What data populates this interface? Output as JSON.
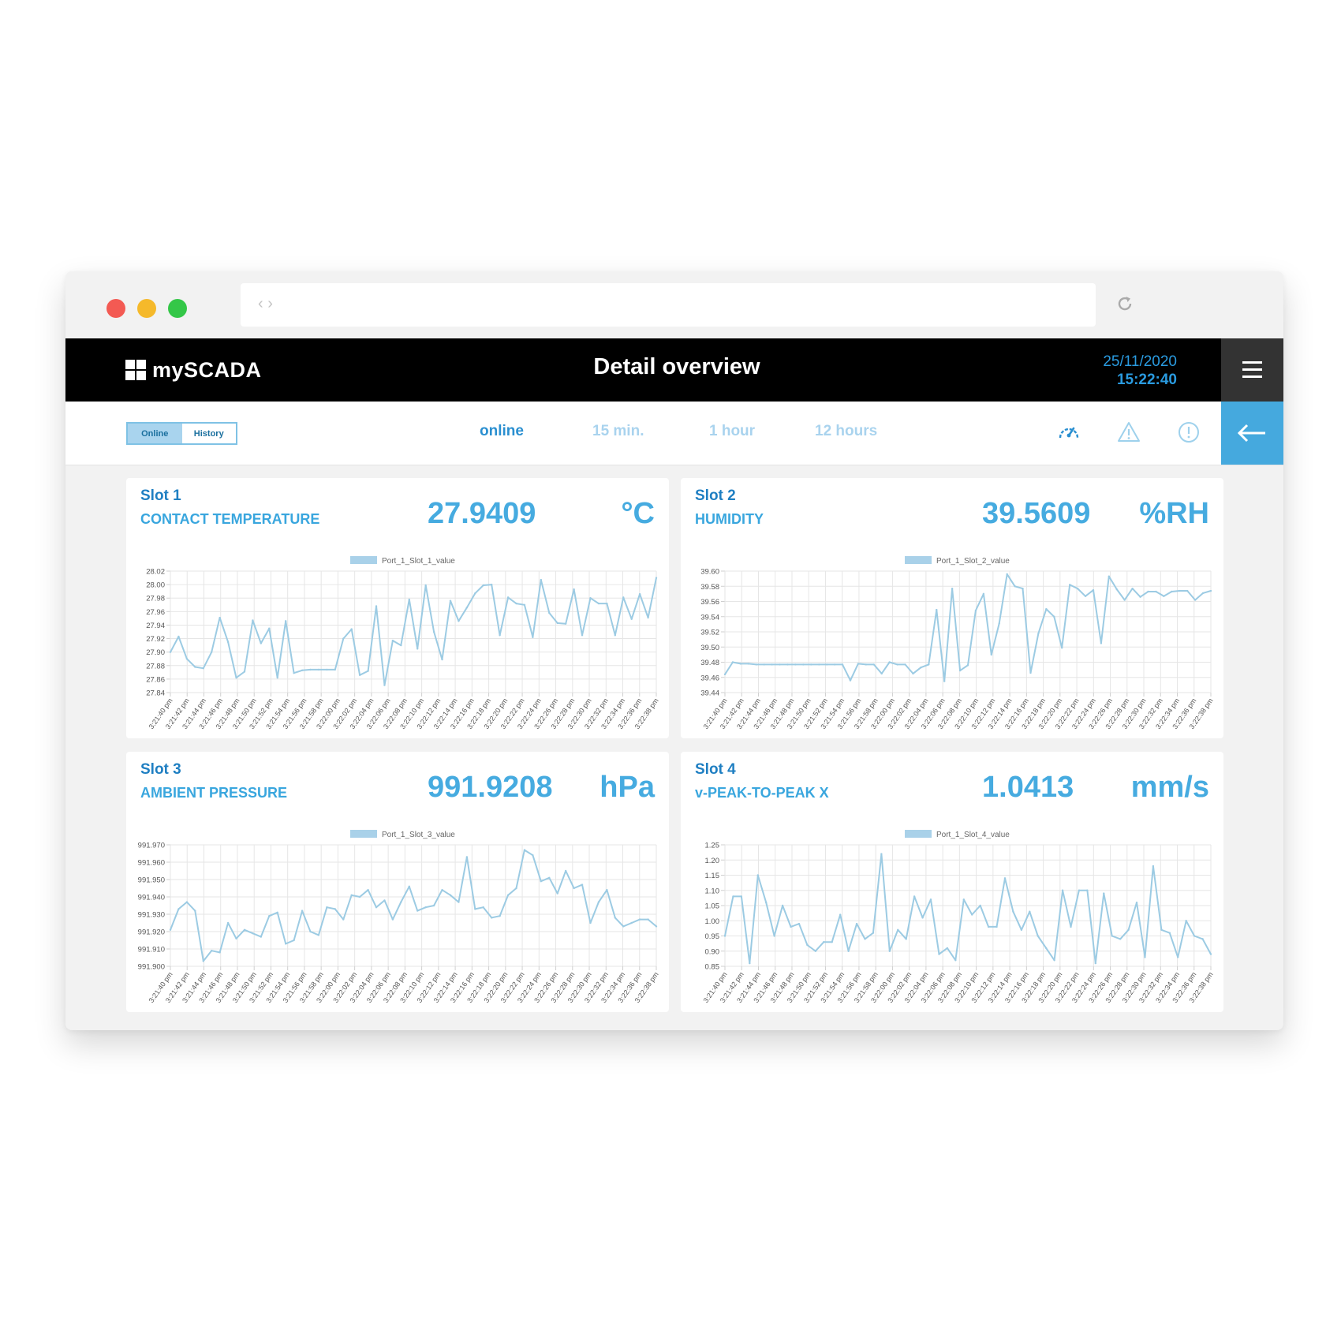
{
  "page": {
    "title": "Detail overview",
    "date": "25/11/2020",
    "time": "15:22:40",
    "app_name": "mySCADA"
  },
  "colors": {
    "accent": "#46abe0",
    "accent_dark": "#1f7fc2",
    "line": "#9ccbe3",
    "topbar": "#000000",
    "back_button": "#45a9de",
    "active_tab": "#2a8fd0",
    "inactive_tab": "#a9d3ee"
  },
  "view_toggle": {
    "online": "Online",
    "history": "History",
    "selected": "Online"
  },
  "ranges": [
    {
      "label": "online",
      "active": true
    },
    {
      "label": "15 min.",
      "active": false
    },
    {
      "label": "1 hour",
      "active": false
    },
    {
      "label": "12 hours",
      "active": false
    }
  ],
  "toolbar_icons": [
    "speedometer-icon",
    "warning-icon",
    "info-icon",
    "back-arrow-icon",
    "menu-icon"
  ],
  "times": [
    "3:21:40 pm",
    "3:21:42 pm",
    "3:21:44 pm",
    "3:21:46 pm",
    "3:21:48 pm",
    "3:21:50 pm",
    "3:21:52 pm",
    "3:21:54 pm",
    "3:21:56 pm",
    "3:21:58 pm",
    "3:22:00 pm",
    "3:22:02 pm",
    "3:22:04 pm",
    "3:22:06 pm",
    "3:22:08 pm",
    "3:22:10 pm",
    "3:22:12 pm",
    "3:22:14 pm",
    "3:22:16 pm",
    "3:22:18 pm",
    "3:22:20 pm",
    "3:22:22 pm",
    "3:22:24 pm",
    "3:22:26 pm",
    "3:22:28 pm",
    "3:22:30 pm",
    "3:22:32 pm",
    "3:22:34 pm",
    "3:22:36 pm",
    "3:22:38 pm"
  ],
  "panels": [
    {
      "slot": "Slot 1",
      "name": "CONTACT TEMPERATURE",
      "value": "27.9409",
      "unit": "°C"
    },
    {
      "slot": "Slot 2",
      "name": "HUMIDITY",
      "value": "39.5609",
      "unit": "%RH"
    },
    {
      "slot": "Slot 3",
      "name": "AMBIENT PRESSURE",
      "value": "991.9208",
      "unit": "hPa"
    },
    {
      "slot": "Slot 4",
      "name": "v-PEAK-TO-PEAK X",
      "value": "1.0413",
      "unit": "mm/s"
    }
  ],
  "chart_data": [
    {
      "type": "line",
      "title": "",
      "series": [
        {
          "name": "Port_1_Slot_1_value",
          "values": [
            27.9,
            27.923,
            27.89,
            27.878,
            27.876,
            27.9,
            27.951,
            27.915,
            27.862,
            27.871,
            27.947,
            27.913,
            27.935,
            27.862,
            27.946,
            27.869,
            27.873,
            27.874,
            27.874,
            27.874,
            27.874,
            27.92,
            27.934,
            27.866,
            27.872,
            27.968,
            27.851,
            27.917,
            27.91,
            27.978,
            27.905,
            27.999,
            27.93,
            27.889,
            27.976,
            27.946,
            27.966,
            27.987,
            27.999,
            28.0,
            27.925,
            27.981,
            27.972,
            27.97,
            27.922,
            28.007,
            27.958,
            27.943,
            27.942,
            27.993,
            27.925,
            27.98,
            27.972,
            27.972,
            27.925,
            27.981,
            27.949,
            27.986,
            27.951,
            28.01
          ]
        }
      ],
      "ylim": [
        27.84,
        28.02
      ],
      "yticks": [
        "28.02",
        "28.00",
        "27.98",
        "27.96",
        "27.94",
        "27.92",
        "27.90",
        "27.88",
        "27.86",
        "27.84"
      ],
      "grid": true,
      "legend_position": "top"
    },
    {
      "type": "line",
      "title": "",
      "series": [
        {
          "name": "Port_1_Slot_2_value",
          "values": [
            39.464,
            39.48,
            39.478,
            39.478,
            39.477,
            39.477,
            39.477,
            39.477,
            39.477,
            39.477,
            39.477,
            39.477,
            39.477,
            39.477,
            39.477,
            39.477,
            39.456,
            39.478,
            39.477,
            39.477,
            39.465,
            39.48,
            39.477,
            39.477,
            39.465,
            39.473,
            39.477,
            39.549,
            39.455,
            39.577,
            39.469,
            39.476,
            39.548,
            39.57,
            39.49,
            39.531,
            39.596,
            39.58,
            39.577,
            39.466,
            39.518,
            39.55,
            39.54,
            39.499,
            39.582,
            39.577,
            39.567,
            39.575,
            39.505,
            39.593,
            39.576,
            39.562,
            39.577,
            39.566,
            39.573,
            39.573,
            39.567,
            39.573,
            39.574,
            39.574,
            39.562,
            39.571,
            39.574
          ]
        }
      ],
      "ylim": [
        39.44,
        39.6
      ],
      "yticks": [
        "39.60",
        "39.58",
        "39.56",
        "39.54",
        "39.52",
        "39.50",
        "39.48",
        "39.46",
        "39.44"
      ],
      "grid": true,
      "legend_position": "top"
    },
    {
      "type": "line",
      "title": "",
      "series": [
        {
          "name": "Port_1_Slot_3_value",
          "values": [
            991.921,
            991.933,
            991.937,
            991.932,
            991.903,
            991.909,
            991.908,
            991.925,
            991.916,
            991.921,
            991.919,
            991.917,
            991.929,
            991.931,
            991.913,
            991.915,
            991.932,
            991.92,
            991.918,
            991.934,
            991.933,
            991.927,
            991.941,
            991.94,
            991.944,
            991.934,
            991.938,
            991.927,
            991.937,
            991.946,
            991.932,
            991.934,
            991.935,
            991.944,
            991.941,
            991.937,
            991.963,
            991.933,
            991.934,
            991.928,
            991.929,
            991.941,
            991.945,
            991.967,
            991.964,
            991.949,
            991.951,
            991.942,
            991.955,
            991.945,
            991.947,
            991.925,
            991.937,
            991.944,
            991.928,
            991.923,
            991.925,
            991.927,
            991.927,
            991.923
          ]
        }
      ],
      "ylim": [
        991.9,
        991.97
      ],
      "yticks": [
        "991.970",
        "991.960",
        "991.950",
        "991.940",
        "991.930",
        "991.920",
        "991.910",
        "991.900"
      ],
      "grid": true,
      "legend_position": "top"
    },
    {
      "type": "line",
      "title": "",
      "series": [
        {
          "name": "Port_1_Slot_4_value",
          "values": [
            0.95,
            1.08,
            1.08,
            0.86,
            1.15,
            1.06,
            0.95,
            1.05,
            0.98,
            0.99,
            0.92,
            0.9,
            0.93,
            0.93,
            1.02,
            0.9,
            0.99,
            0.94,
            0.96,
            1.22,
            0.9,
            0.97,
            0.94,
            1.08,
            1.01,
            1.07,
            0.89,
            0.91,
            0.87,
            1.07,
            1.02,
            1.05,
            0.98,
            0.98,
            1.14,
            1.03,
            0.97,
            1.03,
            0.95,
            0.91,
            0.87,
            1.1,
            0.98,
            1.1,
            1.1,
            0.86,
            1.09,
            0.95,
            0.94,
            0.97,
            1.06,
            0.88,
            1.18,
            0.97,
            0.96,
            0.88,
            1.0,
            0.95,
            0.94,
            0.89
          ]
        }
      ],
      "ylim": [
        0.85,
        1.25
      ],
      "yticks": [
        "1.25",
        "1.20",
        "1.15",
        "1.10",
        "1.05",
        "1.00",
        "0.95",
        "0.90",
        "0.85"
      ],
      "grid": true,
      "legend_position": "top"
    }
  ]
}
